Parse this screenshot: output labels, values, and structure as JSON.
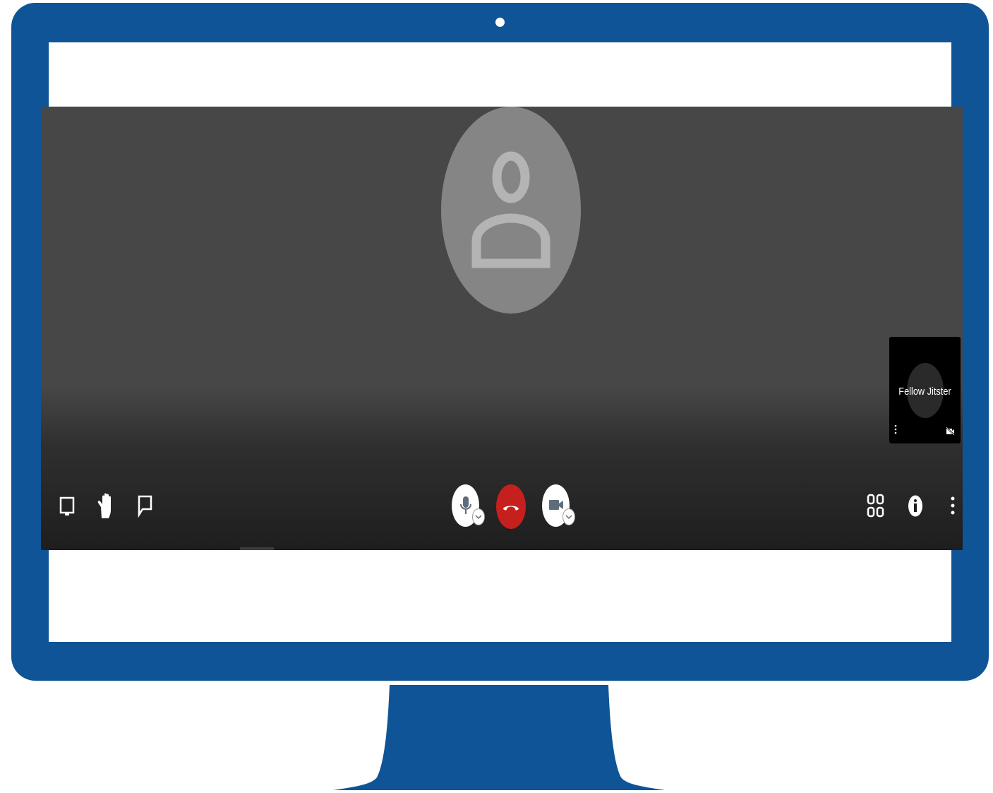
{
  "device": {
    "frame_color": "#0f5496",
    "screen_color": "#ffffff"
  },
  "conference": {
    "background_color": "#474747",
    "large_video": {
      "avatar_icon": "user-avatar-icon",
      "avatar_color": "#858585"
    },
    "filmstrip": {
      "participants": [
        {
          "name": "Fellow Jitster",
          "avatar_icon": "user-avatar-icon",
          "status_icons": [
            "more-vertical-icon",
            "camera-off-icon"
          ]
        }
      ]
    }
  },
  "toolbar": {
    "left": [
      {
        "name": "share-screen-button",
        "icon": "monitor-icon"
      },
      {
        "name": "raise-hand-button",
        "icon": "hand-icon"
      },
      {
        "name": "chat-button",
        "icon": "chat-bubble-icon"
      }
    ],
    "center": [
      {
        "name": "microphone-button",
        "icon": "microphone-icon",
        "has_options": true
      },
      {
        "name": "hangup-button",
        "icon": "phone-hangup-icon",
        "color": "#c6201e"
      },
      {
        "name": "camera-button",
        "icon": "video-camera-icon",
        "has_options": true
      }
    ],
    "right": [
      {
        "name": "tile-view-button",
        "icon": "tile-grid-icon"
      },
      {
        "name": "info-button",
        "icon": "info-icon"
      },
      {
        "name": "more-options-button",
        "icon": "more-vertical-icon"
      }
    ]
  }
}
